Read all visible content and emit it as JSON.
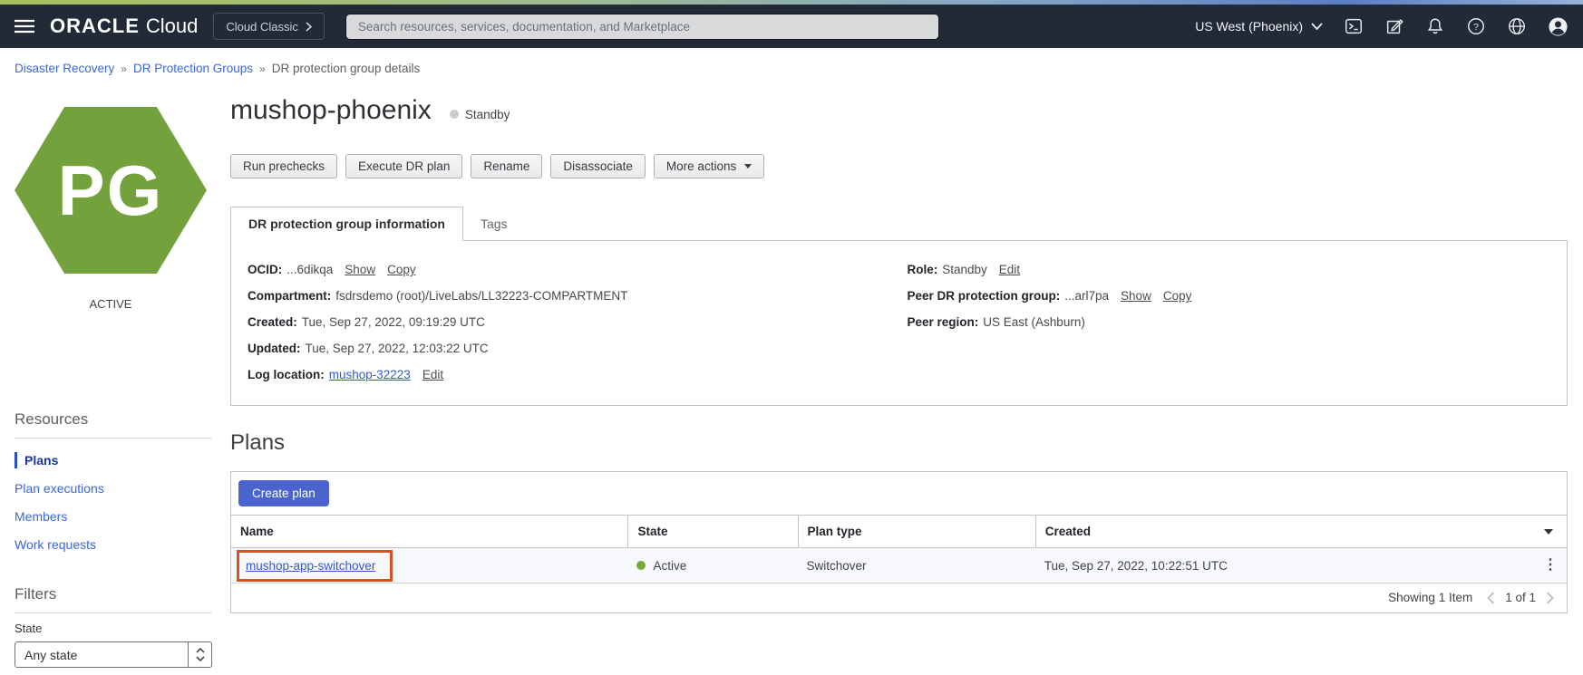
{
  "topbar": {
    "logo_bold": "ORACLE",
    "logo_light": "Cloud",
    "cloud_classic_label": "Cloud Classic",
    "search_placeholder": "Search resources, services, documentation, and Marketplace",
    "region_label": "US West (Phoenix)",
    "icon_names": [
      "cloud-shell",
      "announcements",
      "notifications",
      "help",
      "language",
      "profile"
    ]
  },
  "breadcrumb": {
    "separator": "»",
    "items": [
      {
        "label": "Disaster Recovery"
      },
      {
        "label": "DR Protection Groups"
      },
      {
        "label": "DR protection group details"
      }
    ]
  },
  "page": {
    "title": "mushop-phoenix",
    "status": "Standby"
  },
  "actions": {
    "buttons": [
      "Run prechecks",
      "Execute DR plan",
      "Rename",
      "Disassociate"
    ],
    "more_label": "More actions"
  },
  "tabs": {
    "active": "DR protection group information",
    "inactive": "Tags"
  },
  "info": {
    "ocid": {
      "label": "OCID:",
      "value": "...6dikqa",
      "show": "Show",
      "copy": "Copy"
    },
    "compartment": {
      "label": "Compartment:",
      "value": "fsdrsdemo (root)/LiveLabs/LL32223-COMPARTMENT"
    },
    "created": {
      "label": "Created:",
      "value": "Tue, Sep 27, 2022, 09:19:29 UTC"
    },
    "updated": {
      "label": "Updated:",
      "value": "Tue, Sep 27, 2022, 12:03:22 UTC"
    },
    "log_location": {
      "label": "Log location:",
      "value": "mushop-32223",
      "edit": "Edit"
    },
    "role": {
      "label": "Role:",
      "value": "Standby",
      "edit": "Edit"
    },
    "peer_group": {
      "label": "Peer DR protection group:",
      "value": "...arl7pa",
      "show": "Show",
      "copy": "Copy"
    },
    "peer_region": {
      "label": "Peer region:",
      "value": "US East (Ashburn)"
    }
  },
  "sidebar": {
    "badge_text": "PG",
    "badge_state": "ACTIVE",
    "badge_color": "#73a23c",
    "resources_heading": "Resources",
    "items": [
      {
        "label": "Plans",
        "active": true
      },
      {
        "label": "Plan executions",
        "active": false
      },
      {
        "label": "Members",
        "active": false
      },
      {
        "label": "Work requests",
        "active": false
      }
    ],
    "filters_heading": "Filters",
    "state_label": "State",
    "state_value": "Any state"
  },
  "plans": {
    "heading": "Plans",
    "create_button": "Create plan",
    "columns": [
      "Name",
      "State",
      "Plan type",
      "Created"
    ],
    "rows": [
      {
        "name": "mushop-app-switchover",
        "state": "Active",
        "state_color": "#76a93c",
        "plan_type": "Switchover",
        "created": "Tue, Sep 27, 2022, 10:22:51 UTC"
      }
    ],
    "footer": {
      "showing": "Showing 1 Item",
      "page": "1 of 1"
    }
  },
  "colors": {
    "topbar_bg": "#232a37",
    "accent_blue": "#4a63cd",
    "link_blue": "#3a66d6",
    "annotation_orange": "#d6511d",
    "status_green": "#76a93c",
    "standby_gray": "#c9ccce"
  }
}
